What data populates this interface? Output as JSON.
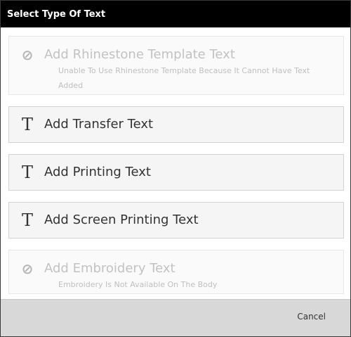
{
  "dialog": {
    "title": "Select Type Of Text"
  },
  "options": [
    {
      "icon": "ban-icon",
      "icon_glyph": "⊘",
      "title": "Add Rhinestone Template Text",
      "description": "Unable To Use Rhinestone Template Because It Cannot Have Text Added",
      "enabled": false
    },
    {
      "icon": "text-icon",
      "icon_glyph": "T",
      "title": "Add Transfer Text",
      "enabled": true
    },
    {
      "icon": "text-icon",
      "icon_glyph": "T",
      "title": "Add Printing Text",
      "enabled": true
    },
    {
      "icon": "text-icon",
      "icon_glyph": "T",
      "title": "Add Screen Printing Text",
      "enabled": true
    },
    {
      "icon": "ban-icon",
      "icon_glyph": "⊘",
      "title": "Add Embroidery Text",
      "description": "Embroidery Is Not Available On The Body",
      "enabled": false
    }
  ],
  "footer": {
    "cancel_label": "Cancel"
  },
  "colors": {
    "titlebar": "#000000",
    "footer": "#d8d8d8",
    "option_bg": "#f5f5f5",
    "disabled_text": "#c2c2c2"
  }
}
